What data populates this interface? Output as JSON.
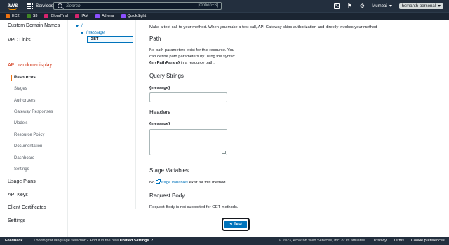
{
  "topnav": {
    "logo": "aws",
    "services_label": "Services",
    "search_placeholder": "Search",
    "search_shortcut": "[Option+S]",
    "region": "Mumbai",
    "account": "hemanth-personal"
  },
  "favorites": [
    {
      "label": "EC2",
      "color": "#ec7211"
    },
    {
      "label": "S3",
      "color": "#3f8624"
    },
    {
      "label": "CloudTrail",
      "color": "#d6246e"
    },
    {
      "label": "IAM",
      "color": "#d6246e"
    },
    {
      "label": "Athena",
      "color": "#8c4fff"
    },
    {
      "label": "QuickSight",
      "color": "#8c4fff"
    }
  ],
  "sidebar": {
    "custom_domain": "Custom Domain Names",
    "vpc_links": "VPC Links",
    "api_title": "API: random-display",
    "sub_items": [
      "Resources",
      "Stages",
      "Authorizers",
      "Gateway Responses",
      "Models",
      "Resource Policy",
      "Documentation",
      "Dashboard",
      "Settings"
    ],
    "bottom_items": [
      "Usage Plans",
      "API Keys",
      "Client Certificates",
      "Settings"
    ]
  },
  "tree": {
    "root": "/",
    "resource": "/message",
    "method": "GET"
  },
  "main": {
    "intro": "Make a test call to your method. When you make a test call, API Gateway skips authorization and directly invokes your method",
    "path_heading": "Path",
    "path_line1": "No path parameters exist for this resource. You",
    "path_line2": "can define path parameters by using the syntax",
    "path_bold": "{myPathParam}",
    "path_line3_rest": " in a resource path.",
    "query_heading": "Query Strings",
    "query_label": "{message}",
    "query_value": "",
    "headers_heading": "Headers",
    "headers_label": "{message}",
    "headers_value": "",
    "stage_heading": "Stage Variables",
    "stage_pre": "No ",
    "stage_link": "stage variables",
    "stage_post": " exist for this method.",
    "body_heading": "Request Body",
    "body_text": "Request Body is not supported for GET methods.",
    "test_button": "Test"
  },
  "footer": {
    "feedback": "Feedback",
    "lang_text": "Looking for language selection? Find it in the new ",
    "lang_link": "Unified Settings",
    "copyright": "© 2023, Amazon Web Services, Inc. or its affiliates.",
    "privacy": "Privacy",
    "terms": "Terms",
    "cookies": "Cookie preferences"
  }
}
